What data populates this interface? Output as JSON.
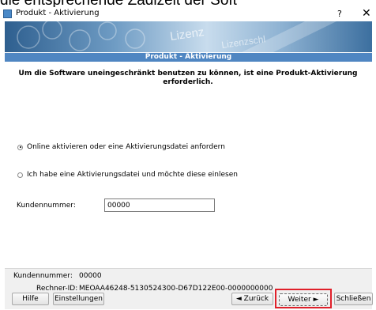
{
  "top_caption": "die entsprechende Zadizeit der Soft",
  "window": {
    "title": "Produkt - Aktivierung",
    "help_symbol": "?",
    "close_symbol": "✕"
  },
  "banner": {
    "watermark_text_1": "Lizenz",
    "watermark_text_2": "Lizenzschl"
  },
  "header": {
    "title": "Produkt - Aktivierung"
  },
  "intro_text": "Um die Software uneingeschränkt benutzen zu können, ist eine Produkt-Aktivierung erforderlich.",
  "options": [
    {
      "label": "Online aktivieren oder eine Aktivierungsdatei anfordern",
      "selected": true
    },
    {
      "label": "Ich habe eine Aktivierungsdatei und möchte diese einlesen",
      "selected": false
    }
  ],
  "customer_field": {
    "label": "Kundennummer:",
    "value": "00000"
  },
  "info": {
    "kundennummer_label": "Kundennummer:",
    "kundennummer_value": "00000",
    "rechner_label": "Rechner-ID:",
    "rechner_value": "MEOAA46248-5130524300-D67D122E00-0000000000"
  },
  "buttons": {
    "hilfe": "Hilfe",
    "einstellungen": "Einstellungen",
    "zurueck": "◄ Zurück",
    "weiter": "Weiter ►",
    "schliessen": "Schließen"
  },
  "colors": {
    "header_bg": "#4f86c2",
    "highlight_border": "#e0202a"
  }
}
